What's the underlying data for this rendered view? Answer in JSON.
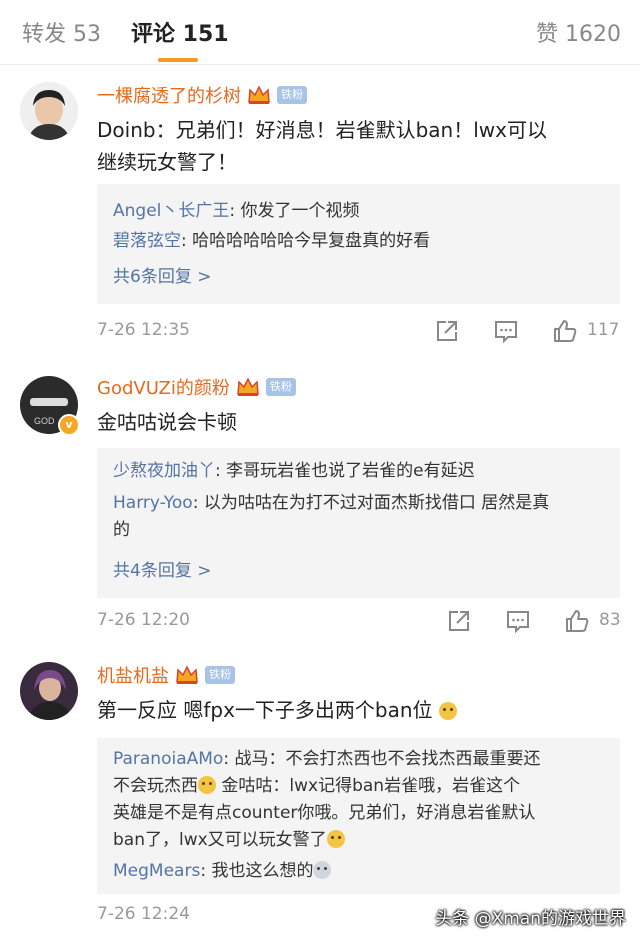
{
  "tabs": {
    "reposts": "转发 53",
    "comments": "评论 151",
    "likes": "赞 1620"
  },
  "comments": [
    {
      "username": "一棵腐透了的杉树",
      "fan_badge": "铁粉",
      "text_line1": "Doinb：兄弟们！好消息！岩雀默认ban！lwx可以",
      "text_line2": "继续玩女警了！",
      "replies": [
        {
          "user": "Angel丶长广王",
          "text": ": 你发了一个视频"
        },
        {
          "user": "碧落弦空",
          "text": ": 哈哈哈哈哈哈今早复盘真的好看"
        }
      ],
      "more": "共6条回复 >",
      "date": "7-26 12:35",
      "likes": "117"
    },
    {
      "username": "GodVUZi的颜粉",
      "fan_badge": "铁粉",
      "text_line1": "金咕咕说会卡顿",
      "replies": [
        {
          "user": "少熬夜加油丫",
          "text": ": 李哥玩岩雀也说了岩雀的e有延迟"
        },
        {
          "user": "Harry-Yoo",
          "text": ": 以为咕咕在为打不过对面杰斯找借口 居然是真",
          "cont": "的"
        }
      ],
      "more": "共4条回复 >",
      "date": "7-26 12:20",
      "likes": "83"
    },
    {
      "username": "机盐机盐",
      "fan_badge": "铁粉",
      "text_line1": "第一反应 嗯fpx一下子多出两个ban位",
      "replies": [
        {
          "user": "ParanoiaAMo",
          "text": ": 战马：不会打杰西也不会找杰西最重要还",
          "line2": "不会玩杰西",
          "line2b": " 金咕咕：lwx记得ban岩雀哦，岩雀这个",
          "line3": "英雄是不是有点counter你哦。兄弟们，好消息岩雀默认",
          "line4": "ban了，lwx又可以玩女警了"
        },
        {
          "user": "MegMears",
          "text": ": 我也这么想的"
        }
      ],
      "date": "7-26 12:24"
    }
  ],
  "watermark": "头条 @Xman的游戏世界",
  "colors": {
    "username": "#e8691b",
    "reply_user": "#5474a6",
    "accent": "#f59a23"
  }
}
